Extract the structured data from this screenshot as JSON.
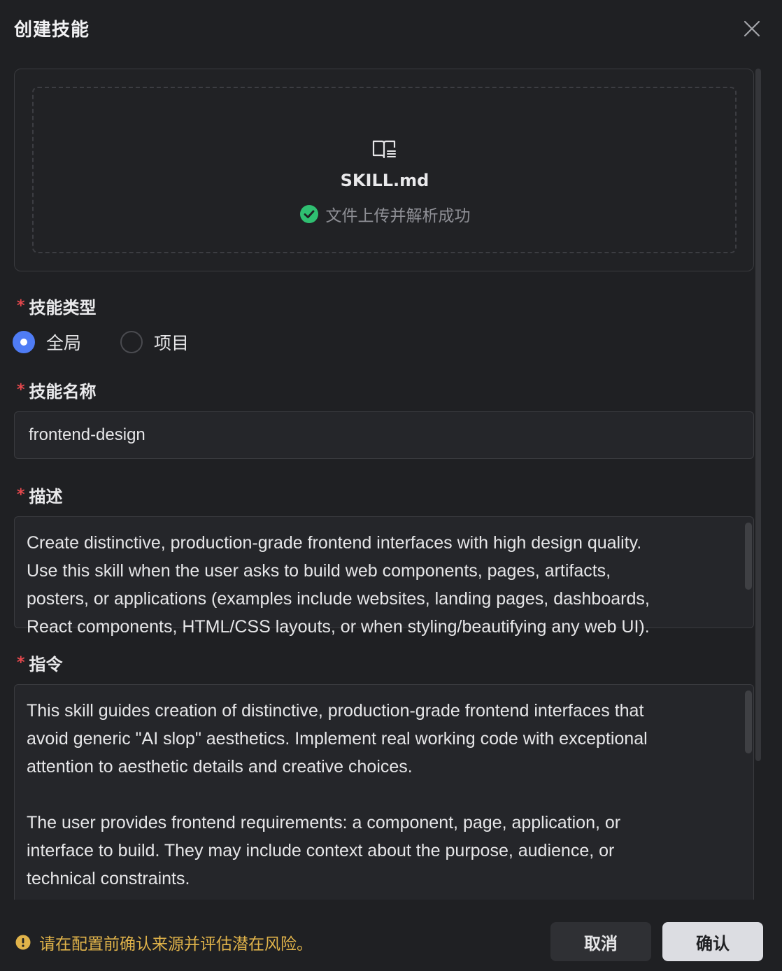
{
  "dialog": {
    "title": "创建技能",
    "close_icon": "close-icon"
  },
  "upload": {
    "file_icon": "book-doc-icon",
    "file_name": "SKILL.md",
    "status_icon": "check-circle-icon",
    "status_text": "文件上传并解析成功",
    "status_color": "#2fbf71"
  },
  "skill_type": {
    "label": "技能类型",
    "required_mark": "*",
    "options": [
      {
        "label": "全局",
        "checked": true
      },
      {
        "label": "项目",
        "checked": false
      }
    ]
  },
  "skill_name": {
    "label": "技能名称",
    "required_mark": "*",
    "value": "frontend-design"
  },
  "description": {
    "label": "描述",
    "required_mark": "*",
    "value": "Create distinctive, production-grade frontend interfaces with high design quality.\nUse this skill when the user asks to build web components, pages, artifacts,\nposters, or applications (examples include websites, landing pages, dashboards,\nReact components, HTML/CSS layouts, or when styling/beautifying any web UI)."
  },
  "instructions": {
    "label": "指令",
    "required_mark": "*",
    "value": "This skill guides creation of distinctive, production-grade frontend interfaces that\navoid generic \"AI slop\" aesthetics. Implement real working code with exceptional\nattention to aesthetic details and creative choices.\n\nThe user provides frontend requirements: a component, page, application, or\ninterface to build. They may include context about the purpose, audience, or\ntechnical constraints."
  },
  "footer": {
    "warning_icon": "info-icon",
    "warning_text": "请在配置前确认来源并评估潜在风险。",
    "warning_color": "#e0b34a",
    "cancel_label": "取消",
    "confirm_label": "确认"
  },
  "colors": {
    "background": "#1f2023",
    "accent": "#4f7cf5",
    "required": "#e5484d"
  }
}
